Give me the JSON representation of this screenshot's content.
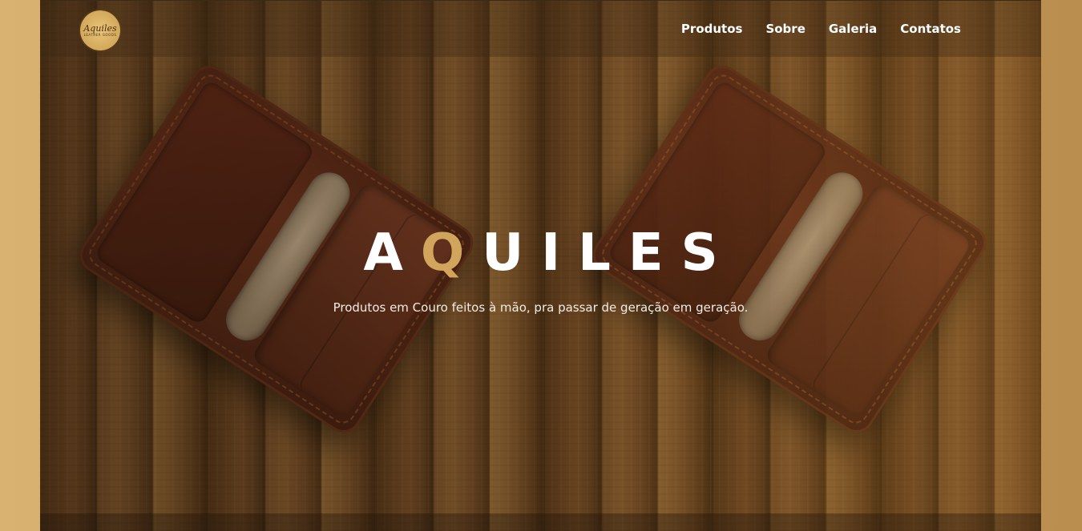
{
  "brand": {
    "logo_text": "Aquiles",
    "logo_subtext": "LEATHER GOODS"
  },
  "nav": {
    "items": [
      {
        "label": "Produtos"
      },
      {
        "label": "Sobre"
      },
      {
        "label": "Galeria"
      },
      {
        "label": "Contatos"
      }
    ]
  },
  "hero": {
    "title_part1": "A",
    "title_accent": "Q",
    "title_part2": "UILES",
    "subtitle": "Produtos em Couro feitos à mão, pra passar de geração em geração."
  },
  "colors": {
    "accent": "#d2a55c",
    "side_background": "#d9b272",
    "text": "#ffffff"
  }
}
